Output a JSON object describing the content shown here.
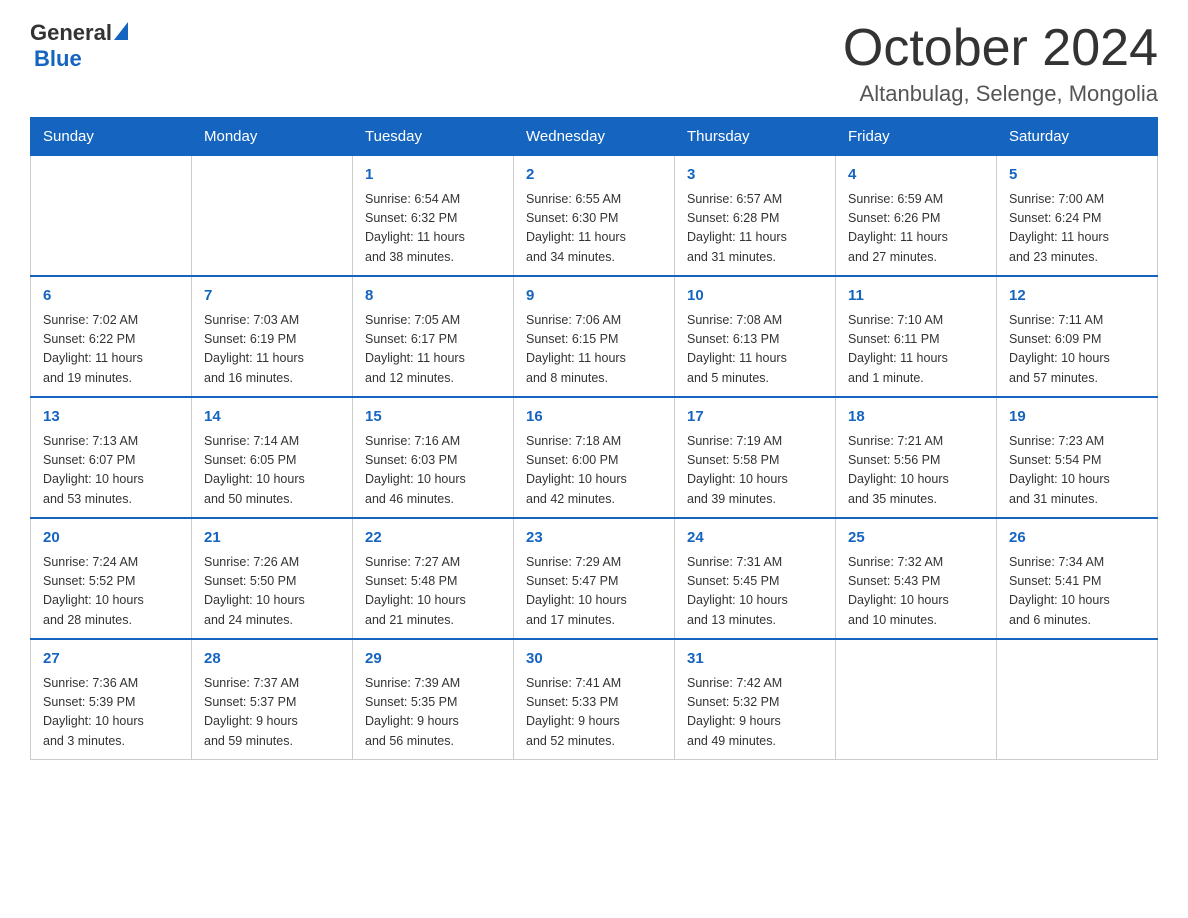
{
  "logo": {
    "text_general": "General",
    "text_blue": "Blue",
    "alt": "GeneralBlue logo"
  },
  "header": {
    "month_title": "October 2024",
    "location": "Altanbulag, Selenge, Mongolia"
  },
  "weekdays": [
    "Sunday",
    "Monday",
    "Tuesday",
    "Wednesday",
    "Thursday",
    "Friday",
    "Saturday"
  ],
  "weeks": [
    [
      {
        "day": "",
        "info": ""
      },
      {
        "day": "",
        "info": ""
      },
      {
        "day": "1",
        "info": "Sunrise: 6:54 AM\nSunset: 6:32 PM\nDaylight: 11 hours\nand 38 minutes."
      },
      {
        "day": "2",
        "info": "Sunrise: 6:55 AM\nSunset: 6:30 PM\nDaylight: 11 hours\nand 34 minutes."
      },
      {
        "day": "3",
        "info": "Sunrise: 6:57 AM\nSunset: 6:28 PM\nDaylight: 11 hours\nand 31 minutes."
      },
      {
        "day": "4",
        "info": "Sunrise: 6:59 AM\nSunset: 6:26 PM\nDaylight: 11 hours\nand 27 minutes."
      },
      {
        "day": "5",
        "info": "Sunrise: 7:00 AM\nSunset: 6:24 PM\nDaylight: 11 hours\nand 23 minutes."
      }
    ],
    [
      {
        "day": "6",
        "info": "Sunrise: 7:02 AM\nSunset: 6:22 PM\nDaylight: 11 hours\nand 19 minutes."
      },
      {
        "day": "7",
        "info": "Sunrise: 7:03 AM\nSunset: 6:19 PM\nDaylight: 11 hours\nand 16 minutes."
      },
      {
        "day": "8",
        "info": "Sunrise: 7:05 AM\nSunset: 6:17 PM\nDaylight: 11 hours\nand 12 minutes."
      },
      {
        "day": "9",
        "info": "Sunrise: 7:06 AM\nSunset: 6:15 PM\nDaylight: 11 hours\nand 8 minutes."
      },
      {
        "day": "10",
        "info": "Sunrise: 7:08 AM\nSunset: 6:13 PM\nDaylight: 11 hours\nand 5 minutes."
      },
      {
        "day": "11",
        "info": "Sunrise: 7:10 AM\nSunset: 6:11 PM\nDaylight: 11 hours\nand 1 minute."
      },
      {
        "day": "12",
        "info": "Sunrise: 7:11 AM\nSunset: 6:09 PM\nDaylight: 10 hours\nand 57 minutes."
      }
    ],
    [
      {
        "day": "13",
        "info": "Sunrise: 7:13 AM\nSunset: 6:07 PM\nDaylight: 10 hours\nand 53 minutes."
      },
      {
        "day": "14",
        "info": "Sunrise: 7:14 AM\nSunset: 6:05 PM\nDaylight: 10 hours\nand 50 minutes."
      },
      {
        "day": "15",
        "info": "Sunrise: 7:16 AM\nSunset: 6:03 PM\nDaylight: 10 hours\nand 46 minutes."
      },
      {
        "day": "16",
        "info": "Sunrise: 7:18 AM\nSunset: 6:00 PM\nDaylight: 10 hours\nand 42 minutes."
      },
      {
        "day": "17",
        "info": "Sunrise: 7:19 AM\nSunset: 5:58 PM\nDaylight: 10 hours\nand 39 minutes."
      },
      {
        "day": "18",
        "info": "Sunrise: 7:21 AM\nSunset: 5:56 PM\nDaylight: 10 hours\nand 35 minutes."
      },
      {
        "day": "19",
        "info": "Sunrise: 7:23 AM\nSunset: 5:54 PM\nDaylight: 10 hours\nand 31 minutes."
      }
    ],
    [
      {
        "day": "20",
        "info": "Sunrise: 7:24 AM\nSunset: 5:52 PM\nDaylight: 10 hours\nand 28 minutes."
      },
      {
        "day": "21",
        "info": "Sunrise: 7:26 AM\nSunset: 5:50 PM\nDaylight: 10 hours\nand 24 minutes."
      },
      {
        "day": "22",
        "info": "Sunrise: 7:27 AM\nSunset: 5:48 PM\nDaylight: 10 hours\nand 21 minutes."
      },
      {
        "day": "23",
        "info": "Sunrise: 7:29 AM\nSunset: 5:47 PM\nDaylight: 10 hours\nand 17 minutes."
      },
      {
        "day": "24",
        "info": "Sunrise: 7:31 AM\nSunset: 5:45 PM\nDaylight: 10 hours\nand 13 minutes."
      },
      {
        "day": "25",
        "info": "Sunrise: 7:32 AM\nSunset: 5:43 PM\nDaylight: 10 hours\nand 10 minutes."
      },
      {
        "day": "26",
        "info": "Sunrise: 7:34 AM\nSunset: 5:41 PM\nDaylight: 10 hours\nand 6 minutes."
      }
    ],
    [
      {
        "day": "27",
        "info": "Sunrise: 7:36 AM\nSunset: 5:39 PM\nDaylight: 10 hours\nand 3 minutes."
      },
      {
        "day": "28",
        "info": "Sunrise: 7:37 AM\nSunset: 5:37 PM\nDaylight: 9 hours\nand 59 minutes."
      },
      {
        "day": "29",
        "info": "Sunrise: 7:39 AM\nSunset: 5:35 PM\nDaylight: 9 hours\nand 56 minutes."
      },
      {
        "day": "30",
        "info": "Sunrise: 7:41 AM\nSunset: 5:33 PM\nDaylight: 9 hours\nand 52 minutes."
      },
      {
        "day": "31",
        "info": "Sunrise: 7:42 AM\nSunset: 5:32 PM\nDaylight: 9 hours\nand 49 minutes."
      },
      {
        "day": "",
        "info": ""
      },
      {
        "day": "",
        "info": ""
      }
    ]
  ]
}
